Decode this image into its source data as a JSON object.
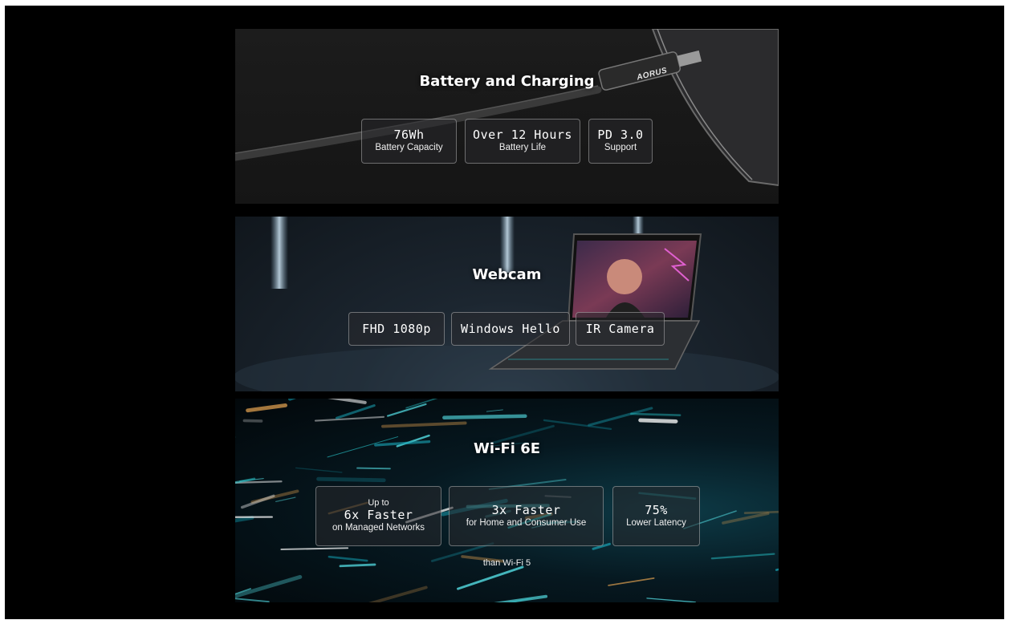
{
  "battery": {
    "title": "Battery and Charging",
    "brand_logo": "AORUS",
    "specs": [
      {
        "value": "76Wh",
        "caption": "Battery Capacity"
      },
      {
        "value": "Over 12 Hours",
        "caption": "Battery Life"
      },
      {
        "value": "PD 3.0",
        "caption": "Support"
      }
    ]
  },
  "webcam": {
    "title": "Webcam",
    "specs": [
      {
        "value": "FHD 1080p"
      },
      {
        "value": "Windows Hello"
      },
      {
        "value": "IR Camera"
      }
    ]
  },
  "wifi": {
    "title": "Wi-Fi 6E",
    "specs": [
      {
        "pre": "Up to",
        "value": "6x Faster",
        "caption": "on Managed Networks"
      },
      {
        "value": "3x Faster",
        "caption": "for Home and Consumer Use"
      },
      {
        "value": "75%",
        "caption": "Lower Latency"
      }
    ],
    "footnote": "than Wi-Fi 5"
  },
  "colors": {
    "background": "#000000",
    "text": "#ffffff",
    "accent_cyan": "#2ad1d6"
  }
}
